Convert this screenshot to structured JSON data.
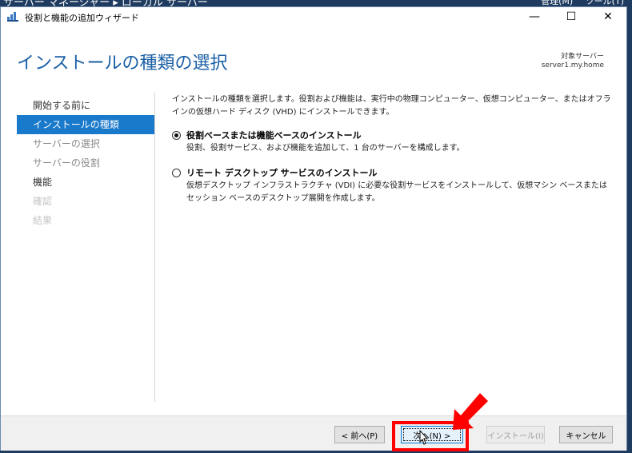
{
  "background": {
    "app_title": "サーバー マネージャー ▸ ローカル サーバー",
    "menu_manage": "管理(M)",
    "menu_tools": "ツール(T)"
  },
  "window": {
    "title": "役割と機能の追加ウィザード",
    "minimize_glyph": "—",
    "maximize_glyph": "☐",
    "close_glyph": "✕"
  },
  "header": {
    "title": "インストールの種類の選択",
    "target_label": "対象サーバー",
    "target_value": "server1.my.home"
  },
  "nav": {
    "items": [
      {
        "label": "開始する前に",
        "state": "normal"
      },
      {
        "label": "インストールの種類",
        "state": "active"
      },
      {
        "label": "サーバーの選択",
        "state": "disabled"
      },
      {
        "label": "サーバーの役割",
        "state": "disabled"
      },
      {
        "label": "機能",
        "state": "normal"
      },
      {
        "label": "確認",
        "state": "dim"
      },
      {
        "label": "結果",
        "state": "dim"
      }
    ]
  },
  "content": {
    "intro": "インストールの種類を選択します。役割および機能は、実行中の物理コンピューター、仮想コンピューター、またはオフラインの仮想ハード ディスク (VHD) にインストールできます。",
    "options": [
      {
        "title": "役割ベースまたは機能ベースのインストール",
        "description": "役割、役割サービス、および機能を追加して、1 台のサーバーを構成します。",
        "selected": true
      },
      {
        "title": "リモート デスクトップ サービスのインストール",
        "description": "仮想デスクトップ インフラストラクチャ (VDI) に必要な役割サービスをインストールして、仮想マシン ベースまたはセッション ベースのデスクトップ展開を作成します。",
        "selected": false
      }
    ]
  },
  "footer": {
    "prev_label": "< 前へ(P)",
    "next_label": "次へ(N) >",
    "install_label": "インストール(I)",
    "cancel_label": "キャンセル"
  },
  "colors": {
    "accent": "#1979ca",
    "title_blue": "#1a5fa6",
    "highlight_red": "#ff0000"
  },
  "icons": {
    "window_icon": "server-manager-icon",
    "annotation_arrow": "red-arrow-icon",
    "cursor": "mouse-cursor-icon"
  }
}
